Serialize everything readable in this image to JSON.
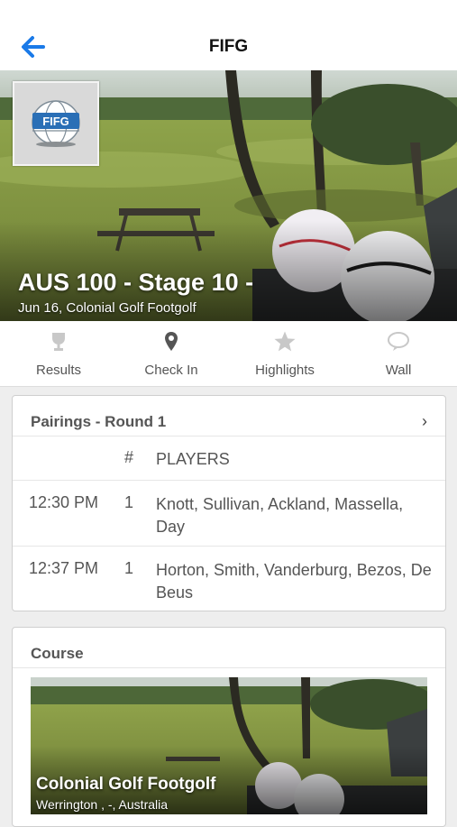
{
  "nav": {
    "title": "FIFG",
    "back_icon": "back-arrow-icon"
  },
  "hero": {
    "logo_text": "FIFG",
    "title": "AUS 100 - Stage 10 -",
    "subtitle": "Jun 16, Colonial Golf Footgolf"
  },
  "tabs": [
    {
      "label": "Results",
      "icon": "trophy-icon"
    },
    {
      "label": "Check In",
      "icon": "location-pin-icon"
    },
    {
      "label": "Highlights",
      "icon": "star-icon"
    },
    {
      "label": "Wall",
      "icon": "chat-bubble-icon"
    }
  ],
  "pairings": {
    "title": "Pairings - Round 1",
    "headers": {
      "num": "#",
      "players": "PLAYERS"
    },
    "rows": [
      {
        "time": "12:30 PM",
        "num": "1",
        "players": "Knott, Sullivan, Ackland, Massella, Day"
      },
      {
        "time": "12:37 PM",
        "num": "1",
        "players": "Horton, Smith, Vanderburg, Bezos, De Beus"
      }
    ]
  },
  "course": {
    "title": "Course",
    "name": "Colonial Golf Footgolf",
    "location": "Werrington , -, Australia"
  },
  "colors": {
    "accent": "#1a7ae8"
  }
}
